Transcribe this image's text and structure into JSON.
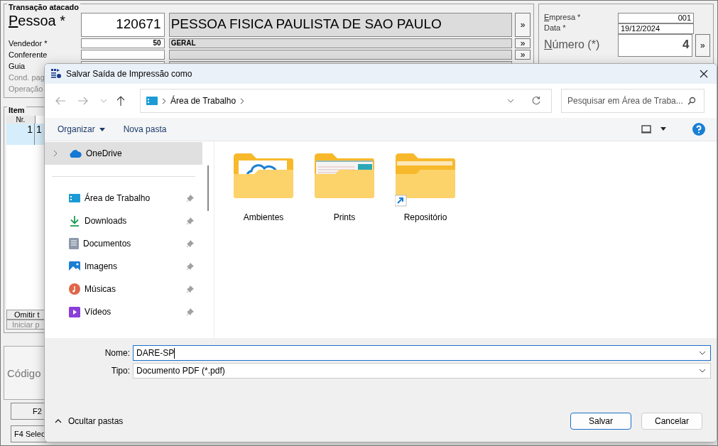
{
  "app": {
    "group_title": "Transação atacado",
    "rows": [
      {
        "kind": "large",
        "label": "Pessoa *",
        "mnemonic": true,
        "code": "120671",
        "name": "PESSOA FISICA PAULISTA DE SAO PAULO",
        "button": "»",
        "disabled": false
      },
      {
        "kind": "normal",
        "label": "Vendedor *",
        "mnemonic": false,
        "code": "50",
        "name": "GERAL",
        "button": "»",
        "disabled": false
      },
      {
        "kind": "normal",
        "label": "Conferente",
        "mnemonic": false,
        "button": "»",
        "disabled": false
      },
      {
        "kind": "normal",
        "label": "Guia",
        "mnemonic": false,
        "disabled": false
      },
      {
        "kind": "normal",
        "label": "Cond. pag",
        "mnemonic": false,
        "disabled": true
      },
      {
        "kind": "normal",
        "label": "Operação",
        "mnemonic": false,
        "disabled": true
      }
    ],
    "right_rows": [
      {
        "kind": "normal",
        "label": "Empresa *",
        "mnemonic": true,
        "value": "001"
      },
      {
        "kind": "date",
        "label": "Data *",
        "mnemonic": false,
        "value": "19/12/2024"
      },
      {
        "kind": "large",
        "label": "Número (*)",
        "mnemonic": true,
        "value": "4",
        "button": "»"
      }
    ],
    "item_title": "Item",
    "item_columns": [
      "Nr."
    ],
    "item_rows": [
      {
        "selected": true,
        "cells": [
          "1",
          "1"
        ]
      }
    ],
    "item_buttons": [
      {
        "label": "Omitir t",
        "disabled": false
      },
      {
        "label": "Iniciar p",
        "disabled": true
      }
    ],
    "code_label": "Código",
    "fkeys": [
      "F2",
      "F4 Selec"
    ]
  },
  "dialog": {
    "title": "Salvar Saída de Impressão como",
    "crumb": "Área de Trabalho",
    "search": {
      "placeholder": "Pesquisar em Área de Traba..."
    },
    "organize": "Organizar",
    "new_folder": "Nova pasta",
    "nav": [
      {
        "label": "OneDrive",
        "kind": "cloud",
        "selected": true,
        "pinned": false,
        "expandable": true
      },
      {
        "label": "Área de Trabalho",
        "kind": "desktop",
        "selected": false,
        "pinned": true,
        "expandable": false
      },
      {
        "label": "Downloads",
        "kind": "download",
        "selected": false,
        "pinned": true,
        "expandable": false
      },
      {
        "label": "Documentos",
        "kind": "documents",
        "selected": false,
        "pinned": true,
        "expandable": false
      },
      {
        "label": "Imagens",
        "kind": "pictures",
        "selected": false,
        "pinned": true,
        "expandable": false
      },
      {
        "label": "Músicas",
        "kind": "music",
        "selected": false,
        "pinned": true,
        "expandable": false
      },
      {
        "label": "Vídeos",
        "kind": "videos",
        "selected": false,
        "pinned": true,
        "expandable": false
      }
    ],
    "folders": [
      {
        "name": "Ambientes",
        "kind": "cloud"
      },
      {
        "name": "Prints",
        "kind": "screenshot"
      },
      {
        "name": "Repositório",
        "kind": "shortcut"
      }
    ],
    "name_field": {
      "label": "Nome:",
      "value": "DARE-SP"
    },
    "type_field": {
      "label": "Tipo:",
      "value": "Documento PDF (*.pdf)"
    },
    "hide_folders": "Ocultar pastas",
    "buttons": [
      {
        "label": "Salvar",
        "kind": "primary"
      },
      {
        "label": "Cancelar",
        "kind": "secondary"
      }
    ]
  }
}
